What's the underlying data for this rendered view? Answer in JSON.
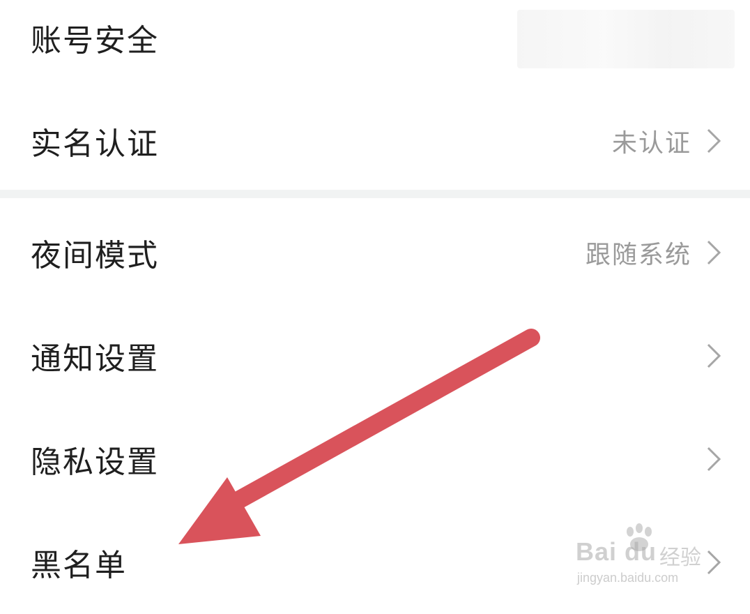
{
  "settings": {
    "rows": [
      {
        "label": "账号安全",
        "value": ""
      },
      {
        "label": "实名认证",
        "value": "未认证"
      },
      {
        "label": "夜间模式",
        "value": "跟随系统"
      },
      {
        "label": "通知设置",
        "value": ""
      },
      {
        "label": "隐私设置",
        "value": ""
      },
      {
        "label": "黑名单",
        "value": ""
      }
    ]
  },
  "annotation": {
    "arrow_color": "#d9535b"
  },
  "watermark": {
    "brand": "Bai  du",
    "product": "经验",
    "url": "jingyan.baidu.com"
  },
  "icons": {
    "row_chevron": "chevron-right-icon",
    "watermark_paw": "paw-icon"
  }
}
